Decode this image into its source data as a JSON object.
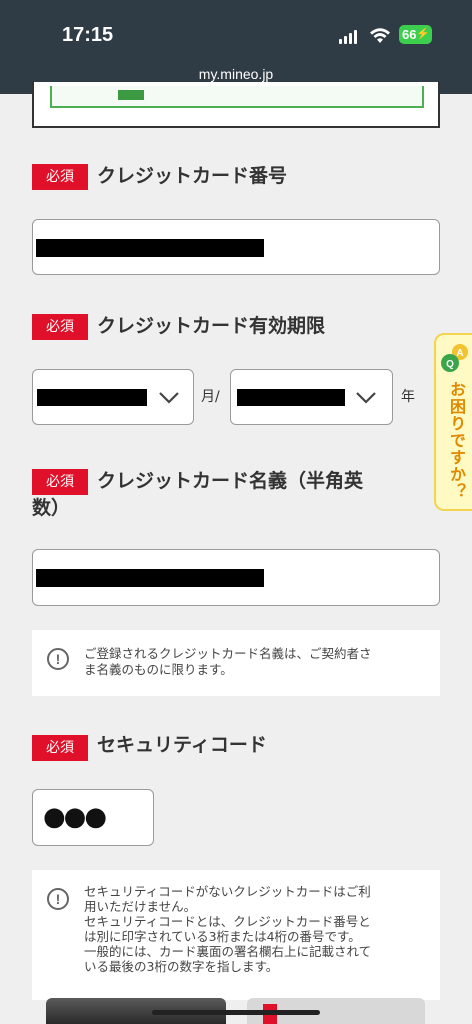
{
  "status_bar": {
    "time": "17:15",
    "battery": "66",
    "url": "my.mineo.jp"
  },
  "required_badge": "必須",
  "card_number": {
    "label": "クレジットカード番号"
  },
  "expiry": {
    "label": "クレジットカード有効期限",
    "month_unit": "月/",
    "year_unit": "年"
  },
  "card_name": {
    "label_line1": "クレジットカード名義（半角英",
    "label_line2": "数）",
    "note_line1": "ご登録されるクレジットカード名義は、ご契約者さ",
    "note_line2": "ま名義のものに限ります。"
  },
  "security_code": {
    "label": "セキュリティコード",
    "value": "●●●",
    "note_lines": [
      "セキュリティコードがないクレジットカードはご利",
      "用いただけません。",
      "セキュリティコードとは、クレジットカード番号と",
      "は別に印字されている3桁または4桁の番号です。",
      "一般的には、カード裏面の署名欄右上に記載されて",
      "いる最後の3桁の数字を指します。"
    ]
  },
  "help_tab": {
    "label": "お困りですか？",
    "icon_a": "A",
    "icon_q": "Q"
  },
  "icons": {
    "info": "info-icon",
    "chevron": "chevron-down-icon"
  }
}
